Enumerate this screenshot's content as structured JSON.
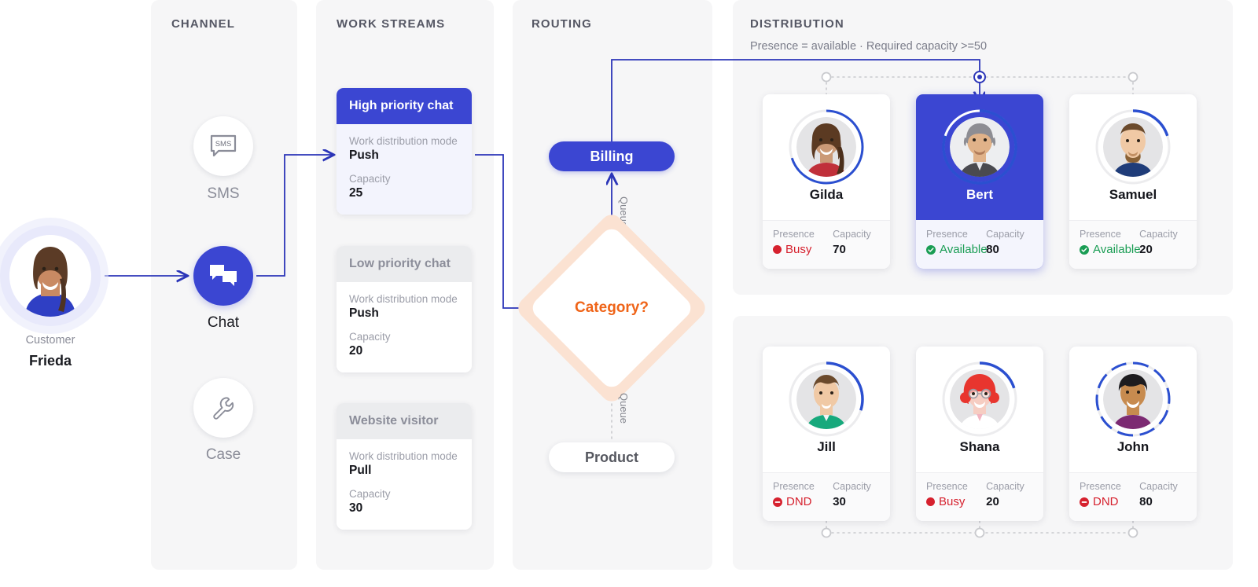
{
  "columns": {
    "channel": {
      "title": "CHANNEL"
    },
    "workstreams": {
      "title": "WORK STREAMS"
    },
    "routing": {
      "title": "ROUTING"
    },
    "distribution": {
      "title": "DISTRIBUTION",
      "subtitle": "Presence = available  ·  Required capacity >=50"
    }
  },
  "customer": {
    "role_label": "Customer",
    "name": "Frieda",
    "avatar_icon": "customer-avatar"
  },
  "channels": [
    {
      "label": "SMS",
      "icon": "sms-icon",
      "active": false
    },
    {
      "label": "Chat",
      "icon": "chat-icon",
      "active": true
    },
    {
      "label": "Case",
      "icon": "wrench-icon",
      "active": false
    }
  ],
  "work_streams": [
    {
      "name": "High priority chat",
      "selected": true,
      "mode_label": "Work distribution mode",
      "mode_value": "Push",
      "capacity_label": "Capacity",
      "capacity_value": "25"
    },
    {
      "name": "Low priority chat",
      "selected": false,
      "mode_label": "Work distribution mode",
      "mode_value": "Push",
      "capacity_label": "Capacity",
      "capacity_value": "20"
    },
    {
      "name": "Website visitor",
      "selected": false,
      "mode_label": "Work distribution mode",
      "mode_value": "Pull",
      "capacity_label": "Capacity",
      "capacity_value": "30"
    }
  ],
  "routing": {
    "queue_billing": {
      "label": "Billing",
      "active": true
    },
    "decision": {
      "label": "Category?"
    },
    "queue_product": {
      "label": "Product",
      "active": false
    },
    "edge_label_top": "Queue",
    "edge_label_bottom": "Queue"
  },
  "agents": {
    "presence_label": "Presence",
    "capacity_label": "Capacity",
    "row_top": [
      {
        "name": "Gilda",
        "presence": "Busy",
        "presence_state": "busy",
        "capacity": "70",
        "selected": false,
        "ring_pct": 70,
        "icon": "avatar-gilda"
      },
      {
        "name": "Bert",
        "presence": "Available",
        "presence_state": "avail",
        "capacity": "80",
        "selected": true,
        "ring_pct": 80,
        "icon": "avatar-bert"
      },
      {
        "name": "Samuel",
        "presence": "Available",
        "presence_state": "avail",
        "capacity": "20",
        "selected": false,
        "ring_pct": 20,
        "icon": "avatar-samuel"
      }
    ],
    "row_bottom": [
      {
        "name": "Jill",
        "presence": "DND",
        "presence_state": "dnd",
        "capacity": "30",
        "selected": false,
        "ring_pct": 30,
        "icon": "avatar-jill"
      },
      {
        "name": "Shana",
        "presence": "Busy",
        "presence_state": "busy",
        "capacity": "20",
        "selected": false,
        "ring_pct": 20,
        "icon": "avatar-shana"
      },
      {
        "name": "John",
        "presence": "DND",
        "presence_state": "dnd",
        "capacity": "80",
        "selected": false,
        "ring_pct": 80,
        "icon": "avatar-john"
      }
    ]
  },
  "colors": {
    "brand_blue": "#3b46d2",
    "panel_bg": "#f6f6f7",
    "orange": "#ef6418",
    "red": "#d6212e",
    "green": "#1a9d54",
    "muted": "#8a8c98"
  }
}
